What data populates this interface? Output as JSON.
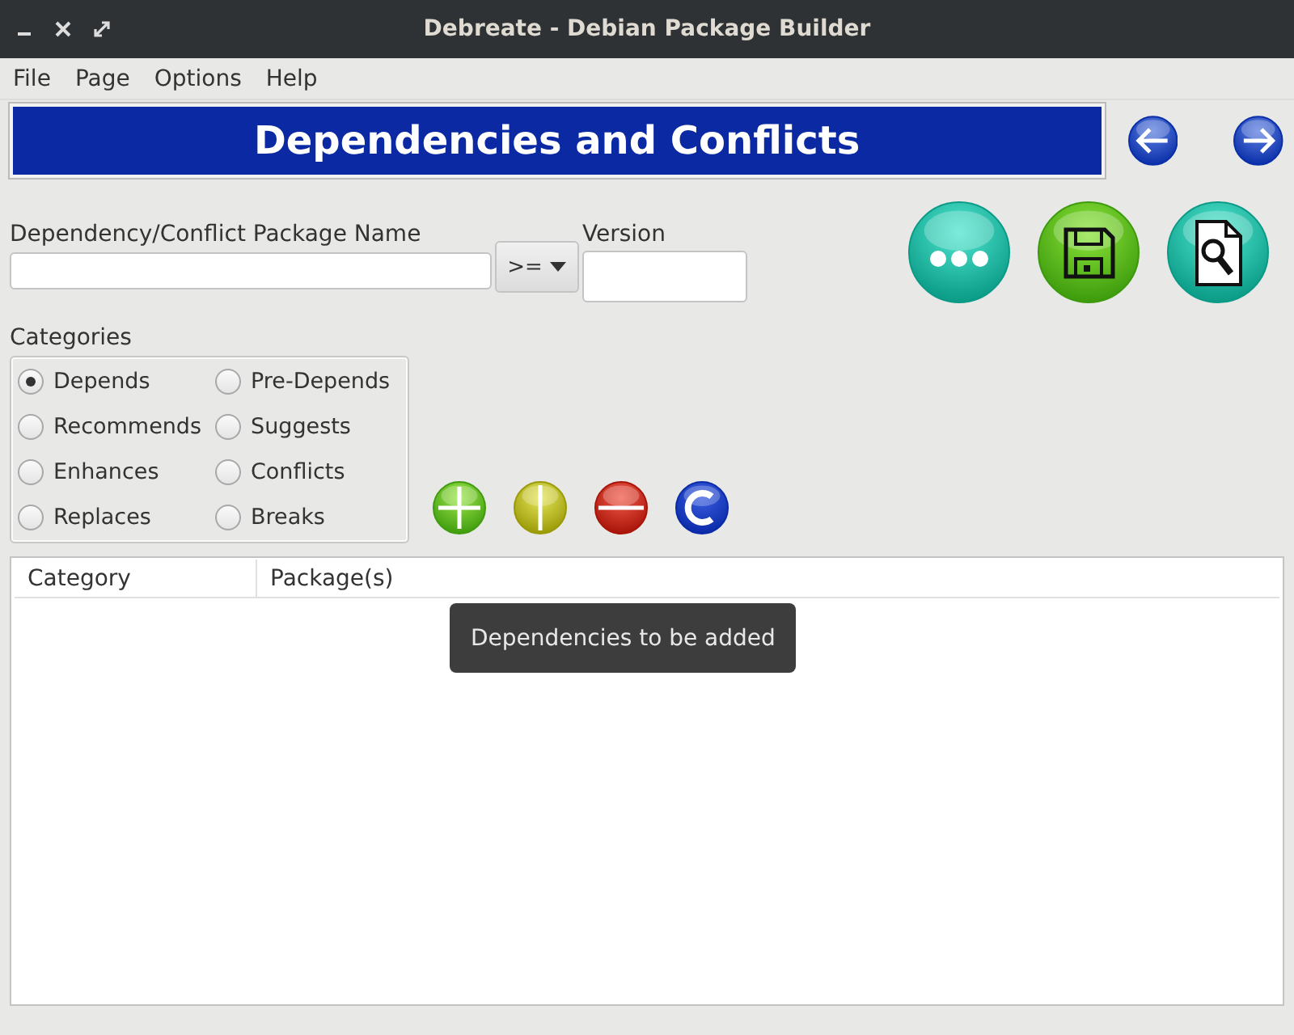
{
  "window": {
    "title": "Debreate - Debian Package Builder"
  },
  "menu": [
    "File",
    "Page",
    "Options",
    "Help"
  ],
  "banner": {
    "title": "Dependencies and Conflicts"
  },
  "name_field": {
    "label": "Dependency/Conflict Package Name"
  },
  "operator": {
    "label": ">="
  },
  "version_field": {
    "label": "Version"
  },
  "categories": {
    "label": "Categories",
    "options": [
      {
        "label": "Depends",
        "selected": true
      },
      {
        "label": "Pre-Depends",
        "selected": false
      },
      {
        "label": "Recommends",
        "selected": false
      },
      {
        "label": "Suggests",
        "selected": false
      },
      {
        "label": "Enhances",
        "selected": false
      },
      {
        "label": "Conflicts",
        "selected": false
      },
      {
        "label": "Replaces",
        "selected": false
      },
      {
        "label": "Breaks",
        "selected": false
      }
    ]
  },
  "table": {
    "columns": [
      "Category",
      "Package(s)"
    ]
  },
  "tooltip": {
    "text": "Dependencies to be added"
  }
}
